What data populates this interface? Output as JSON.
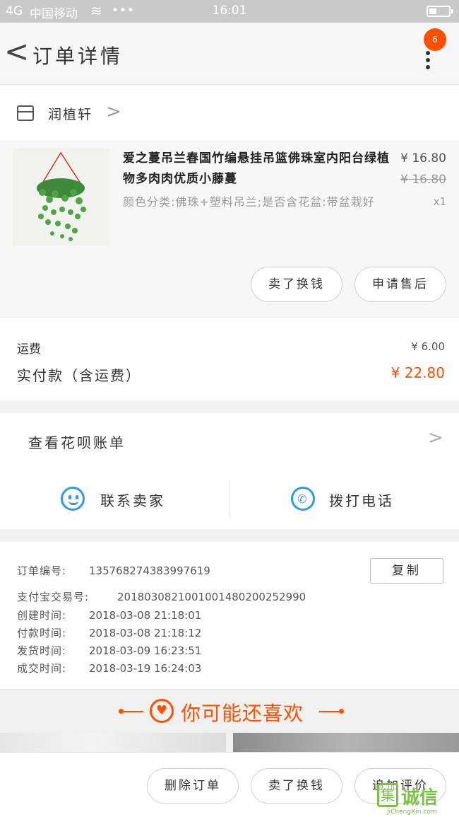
{
  "status_bar": {
    "signal": "4G",
    "carrier": "中国移动",
    "more": "•••",
    "time": "16:01"
  },
  "header": {
    "back": "<",
    "title": "订单详情",
    "badge": "6"
  },
  "shop": {
    "name": "润植轩",
    "chevron": ">"
  },
  "product": {
    "title": "爱之蔓吊兰春国竹编悬挂吊篮佛珠室内阳台绿植物多肉肉优质小藤蔓",
    "spec": "颜色分类:佛珠+塑料吊兰;是否含花盆:带盆栽好",
    "price": "¥ 16.80",
    "original_price": "¥ 16.80",
    "quantity": "x1",
    "buttons": [
      "卖了换钱",
      "申请售后"
    ]
  },
  "totals": {
    "shipping_label": "运费",
    "shipping_value": "¥ 6.00",
    "paid_label": "实付款（含运费）",
    "paid_value": "¥ 22.80"
  },
  "huabei": {
    "label": "查看花呗账单"
  },
  "contact": {
    "seller_label": "联系卖家",
    "phone_label": "拨打电话"
  },
  "order_info": {
    "copy_label": "复制",
    "rows": [
      {
        "key": "订单编号:",
        "value": "135768274383997619"
      },
      {
        "key": "支付宝交易号:",
        "value": "2018030821001001480200252990"
      },
      {
        "key": "创建时间:",
        "value": "2018-03-08  21:18:01"
      },
      {
        "key": "付款时间:",
        "value": "2018-03-08  21:18:12"
      },
      {
        "key": "发货时间:",
        "value": "2018-03-09  16:23:51"
      },
      {
        "key": "成交时间:",
        "value": "2018-03-19  16:24:03"
      }
    ]
  },
  "recommend": {
    "title": "你可能还喜欢"
  },
  "bottom_bar": {
    "buttons": [
      "删除订单",
      "卖了换钱",
      "追加评价"
    ]
  },
  "watermark": {
    "brand": "集诚信",
    "url": "JiChengXin.com"
  },
  "colors": {
    "accent": "#ff5000",
    "link_blue": "#2f9be8",
    "watermark_green": "#7cc242"
  }
}
